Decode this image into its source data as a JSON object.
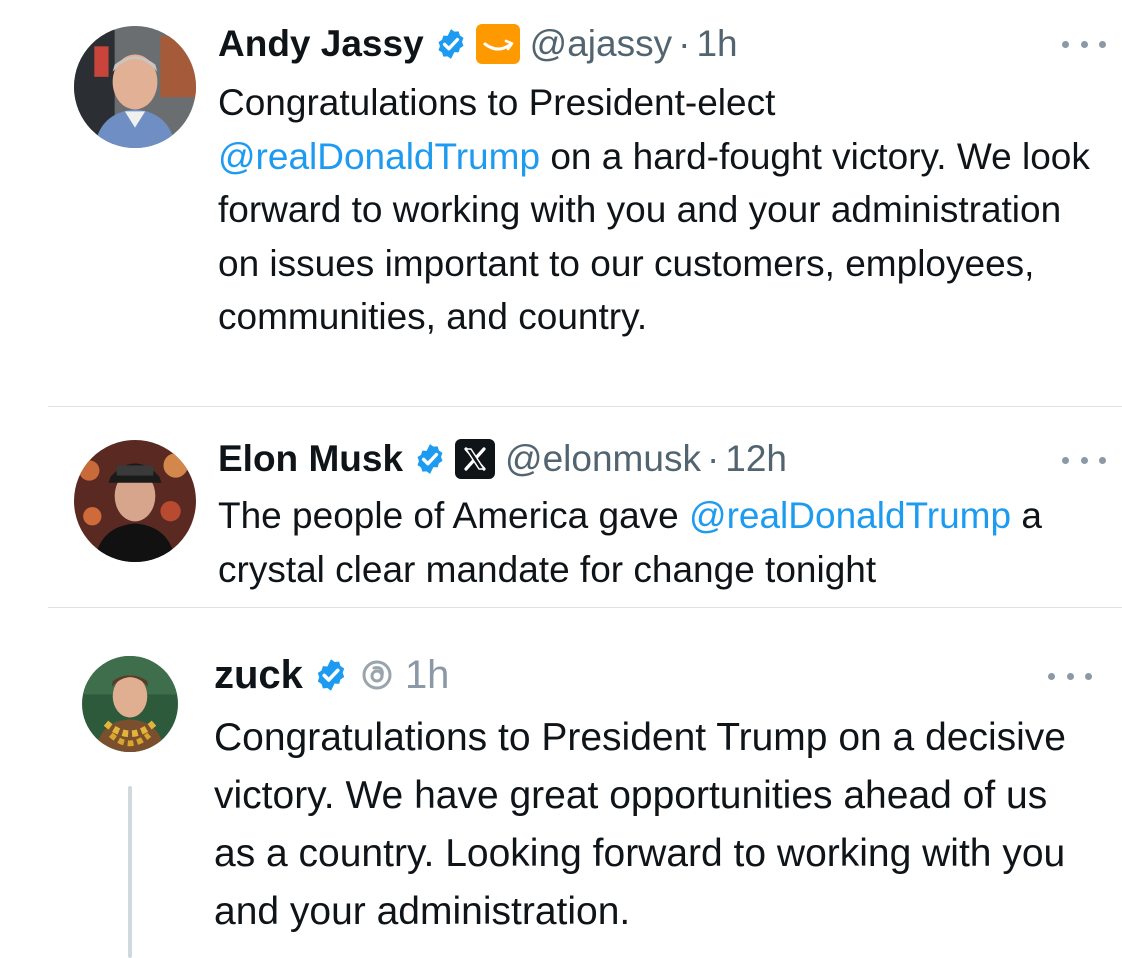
{
  "posts": [
    {
      "name": "Andy Jassy",
      "handle": "@ajassy",
      "time": "1h",
      "verified": true,
      "affiliation": "amazon-badge-icon",
      "text": {
        "p1": "Congratulations to President-elect ",
        "mention": "@realDonaldTrump",
        "p2": " on a hard-fought victory. We look forward to working with you and your administration on issues important to our customers, employees, communities, and country."
      }
    },
    {
      "name": "Elon Musk",
      "handle": "@elonmusk",
      "time": "12h",
      "verified": true,
      "affiliation": "x-badge-icon",
      "text": {
        "p1": "The people of America gave ",
        "mention": "@realDonaldTrump",
        "p2": " a crystal clear mandate for change tonight"
      }
    },
    {
      "name": "zuck",
      "handle": "",
      "time": "1h",
      "verified": true,
      "affiliation": "threads-icon",
      "text": {
        "p1": "Congratulations to President Trump on a decisive victory. We have great opportunities ahead of us as a country. Looking forward to working with you and your administration."
      }
    }
  ],
  "separator": "·",
  "colors": {
    "verified_blue": "#1d9bf0",
    "mention_blue": "#1d9bf0",
    "amazon_orange": "#ff9900",
    "muted_gray": "#536471",
    "text_black": "#0f1419"
  }
}
